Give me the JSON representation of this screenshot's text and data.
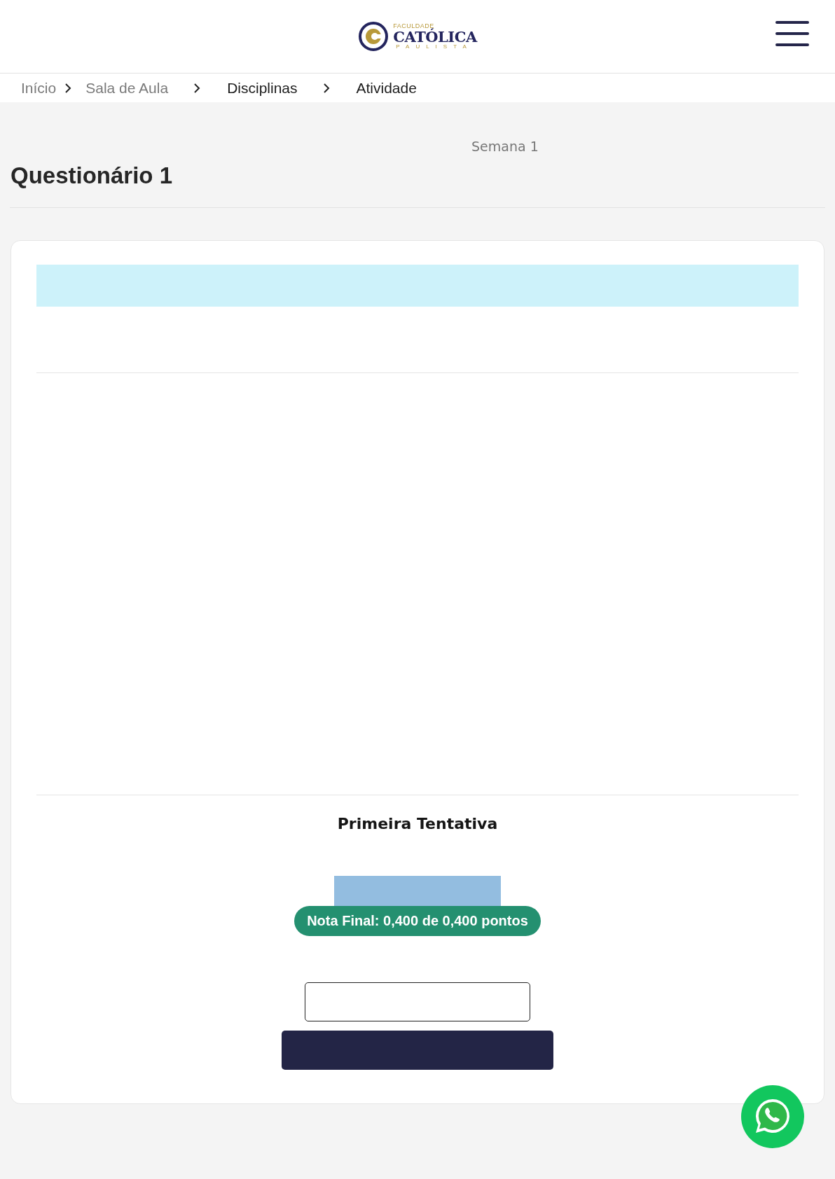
{
  "logo": {
    "top": "FACULDADE",
    "main": "CATÓLICA",
    "bottom": "PAULISTA"
  },
  "breadcrumbs": [
    {
      "label": "Início",
      "current": false
    },
    {
      "label": "Sala de Aula",
      "current": false
    },
    {
      "label": "Disciplinas",
      "current": true
    },
    {
      "label": "Atividade",
      "current": true
    }
  ],
  "week": "Semana 1",
  "title": "Questionário 1",
  "attempt": {
    "title": "Primeira Tentativa",
    "grade": "Nota Final: 0,400 de 0,400 pontos"
  }
}
